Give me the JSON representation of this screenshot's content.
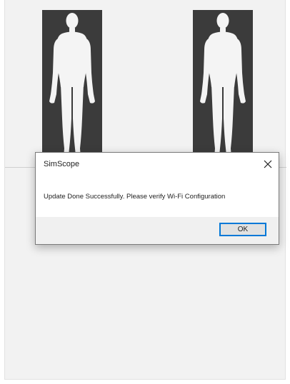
{
  "window": {
    "background": "#f2f2f2"
  },
  "body_map": {
    "panel_color": "#3b3b3b",
    "figure_color": "#f4f4f4",
    "panels": [
      {
        "id": "front",
        "icon": "human-body-front-icon"
      },
      {
        "id": "back",
        "icon": "human-body-back-icon"
      }
    ]
  },
  "dialog": {
    "title": "SimScope",
    "message": "Update Done Successfully. Please verify Wi-Fi Configuration",
    "ok_label": "OK",
    "close_icon": "close-icon",
    "accent": "#0078d7"
  }
}
